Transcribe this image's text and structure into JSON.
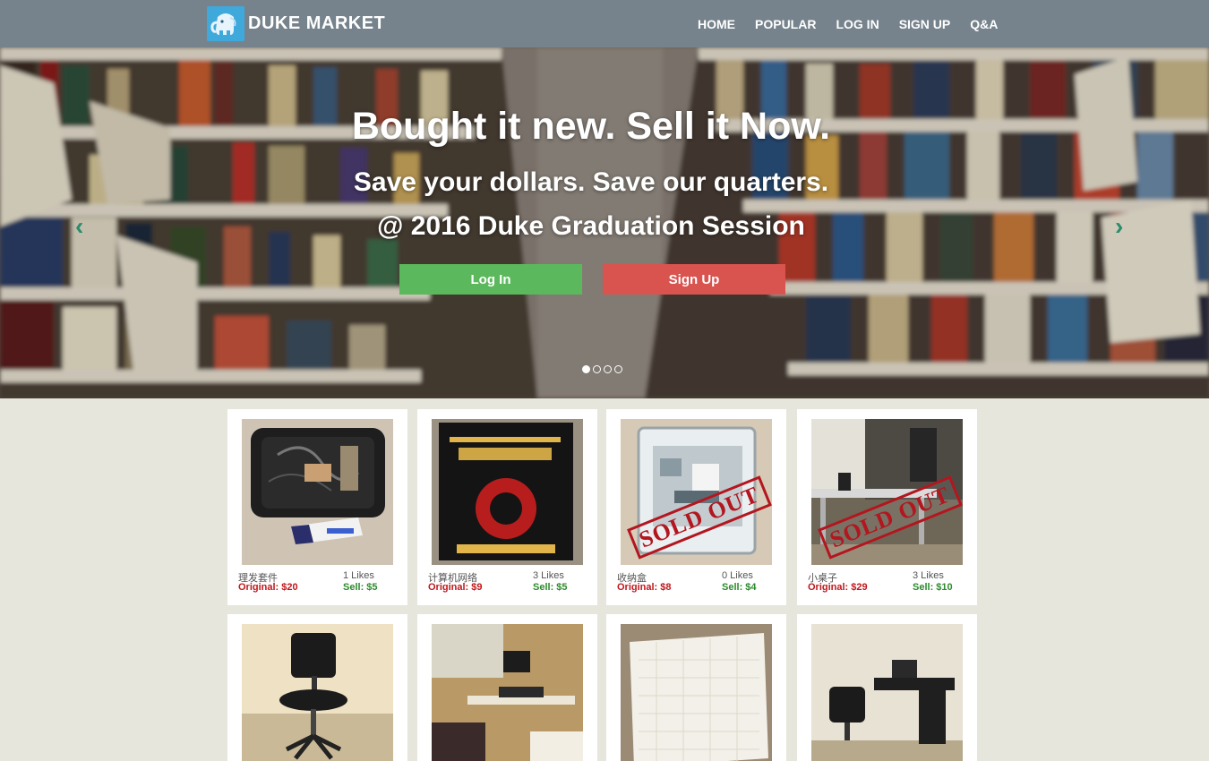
{
  "brand": {
    "name": "DUKE MARKET",
    "logo_icon": "elephant-icon"
  },
  "nav": {
    "items": [
      "HOME",
      "POPULAR",
      "LOG IN",
      "SIGN UP",
      "Q&A"
    ]
  },
  "hero": {
    "title": "Bought it new. Sell it Now.",
    "subtitle1": "Save your dollars. Save our quarters.",
    "subtitle2": "@ 2016 Duke Graduation Session",
    "login_label": "Log In",
    "signup_label": "Sign Up",
    "slide_count": 4,
    "active_slide": 0
  },
  "products": [
    {
      "name": "理发套件",
      "likes": "1 Likes",
      "original": "Original: $20",
      "sell": "Sell: $5"
    },
    {
      "name": "计算机网络",
      "likes": "3 Likes",
      "original": "Original: $9",
      "sell": "Sell: $5"
    },
    {
      "name": "收纳盒",
      "likes": "0 Likes",
      "original": "Original: $8",
      "sell": "Sell: $4",
      "sold_out": "SOLD OUT"
    },
    {
      "name": "小桌子",
      "likes": "3 Likes",
      "original": "Original: $29",
      "sell": "Sell: $10",
      "sold_out": "SOLD OUT"
    },
    {
      "name": ""
    },
    {
      "name": ""
    },
    {
      "name": ""
    },
    {
      "name": ""
    }
  ],
  "colors": {
    "navbar": "#76838c",
    "login": "#5cb85c",
    "signup": "#d9534f",
    "page_bg": "#e6e6dc",
    "price_original": "#c0171b",
    "price_sell": "#2d8a2d"
  }
}
